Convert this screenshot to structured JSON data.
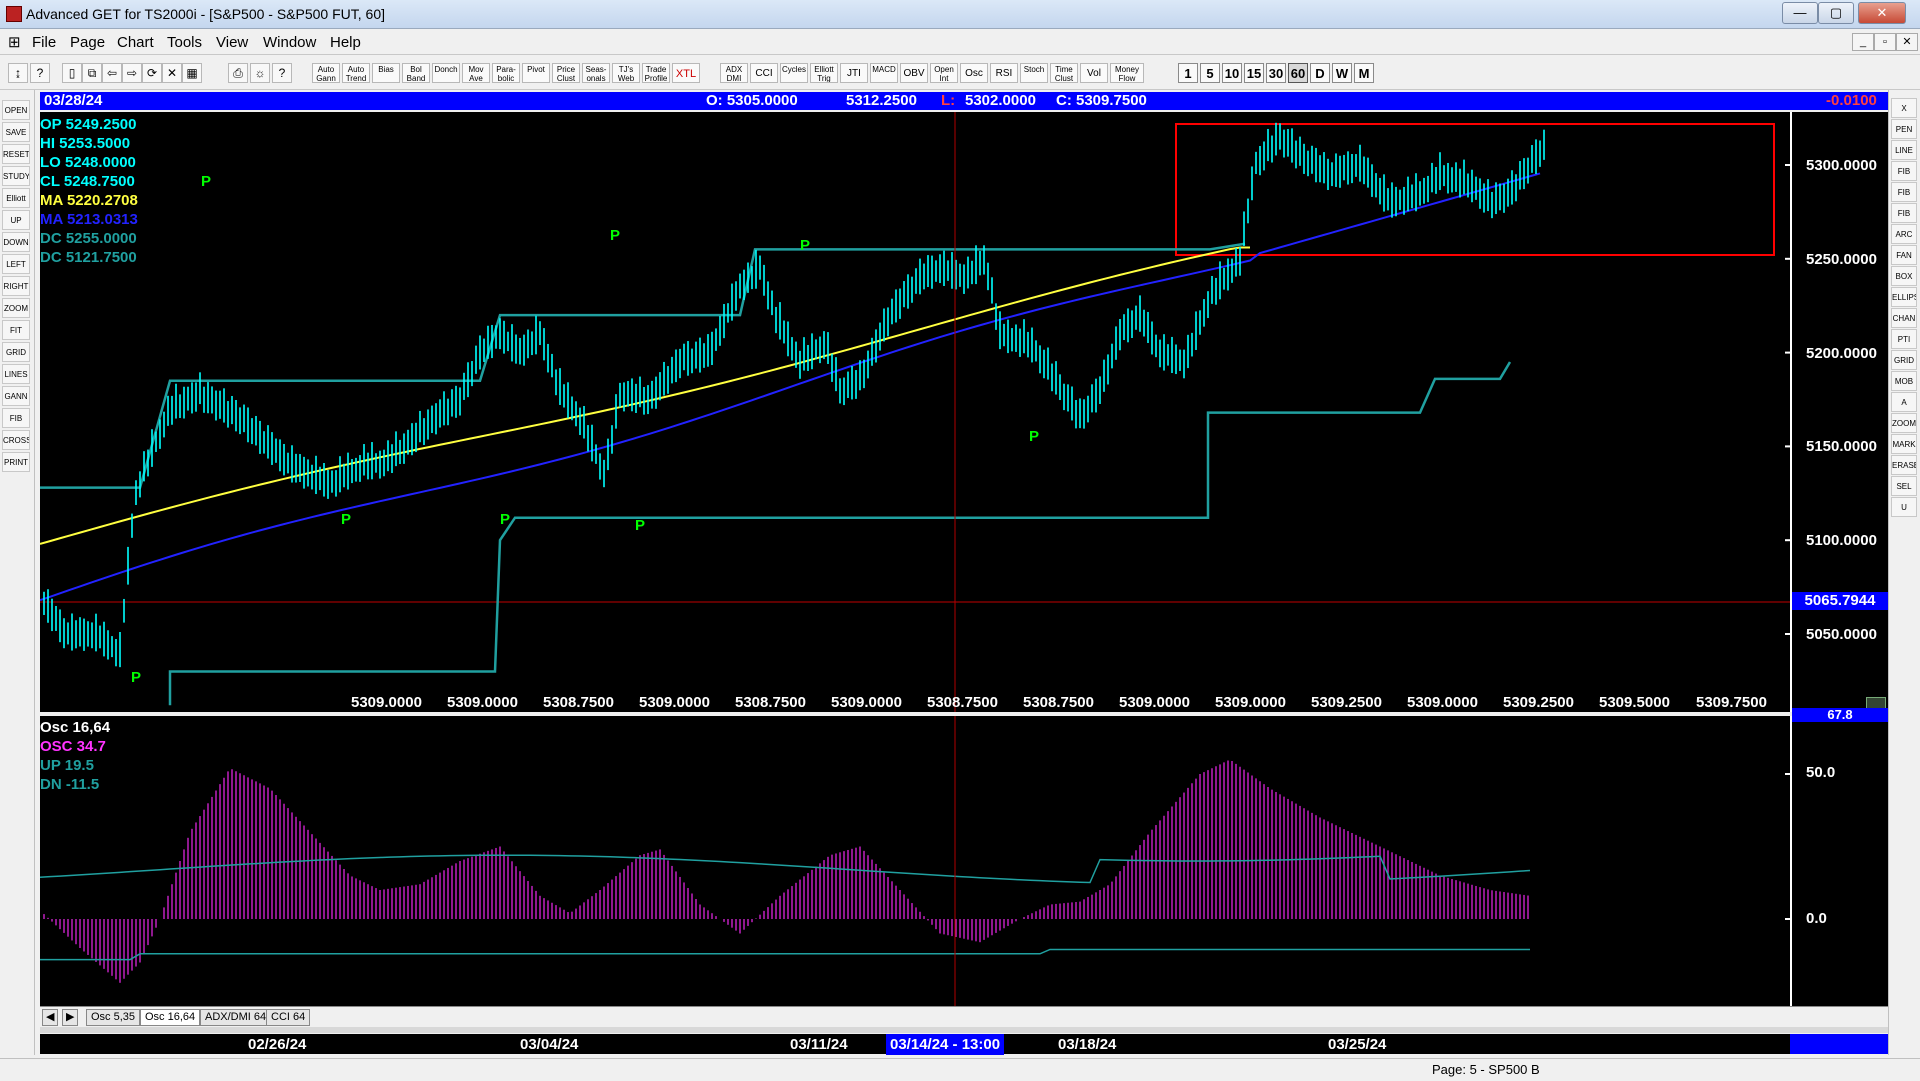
{
  "window": {
    "title": "Advanced GET for TS2000i - [S&P500 - S&P500 FUT, 60]",
    "minimize": "—",
    "maximize": "▢",
    "close": "✕"
  },
  "menu": {
    "items": [
      "File",
      "Page",
      "Chart",
      "Tools",
      "View",
      "Window",
      "Help"
    ],
    "mdi": [
      "_",
      "▫",
      "✕"
    ]
  },
  "toolbar": {
    "studies": [
      "Auto Gann",
      "Auto Trend",
      "Bias",
      "Bol Band",
      "Donch",
      "Mov Ave",
      "Para- bolic",
      "Pivot",
      "Price Clust",
      "Seas- onals",
      "TJ's Web",
      "Trade Profile",
      "XTL",
      "ADX DMI",
      "CCI",
      "Cycles",
      "Elliott Trig",
      "JTI",
      "MACD",
      "OBV",
      "Open Int",
      "Osc",
      "RSI",
      "Stoch",
      "Time Clust",
      "Vol",
      "Money Flow"
    ],
    "timeframes": [
      "1",
      "5",
      "10",
      "15",
      "30",
      "60",
      "D",
      "W",
      "M"
    ],
    "active_timeframe": "60"
  },
  "left_tools": [
    "OPEN",
    "SAVE",
    "RESET",
    "STUDY",
    "Elliott",
    "UP",
    "DOWN",
    "LEFT",
    "RIGHT",
    "ZOOM",
    "FIT",
    "GRID",
    "LINES",
    "GANN",
    "FIB",
    "CROSS",
    "PRINT"
  ],
  "right_tools": [
    "X",
    "PEN",
    "LINE",
    "FIB RET",
    "FIB EXT",
    "FIB TIME",
    "ARC",
    "FAN",
    "BOX",
    "ELLIPSE",
    "CHAN",
    "PTI",
    "GRID",
    "MOB",
    "A",
    "ZOOM",
    "MARK",
    "ERASE",
    "SEL",
    "U"
  ],
  "header": {
    "date": "03/28/24",
    "open": "O: 5305.0000",
    "high": "5312.2500",
    "low_label": "L:",
    "low": "5302.0000",
    "close": "C: 5309.7500",
    "change": "-0.0100"
  },
  "price_legend": {
    "op": "OP  5249.2500",
    "hi": "HI   5253.5000",
    "lo": "LO  5248.0000",
    "cl": "CL  5248.7500",
    "ma1": "MA  5220.2708",
    "ma2": "MA  5213.0313",
    "dc_hi": "DC  5255.0000",
    "dc_lo": "DC  5121.7500"
  },
  "price_axis": {
    "ticks": [
      "5300.0000",
      "5250.0000",
      "5200.0000",
      "5150.0000",
      "5100.0000",
      "5050.0000"
    ],
    "cursor_value": "5065.7944"
  },
  "dc_values": [
    "5309.0000",
    "5309.0000",
    "5308.7500",
    "5309.0000",
    "5308.7500",
    "5309.0000",
    "5308.7500",
    "5308.7500",
    "5309.0000",
    "5309.0000",
    "5309.2500",
    "5309.0000",
    "5309.2500",
    "5309.5000"
  ],
  "dc_last": "5309.7500",
  "pivot_label": "P",
  "osc_legend": {
    "title": "Osc 16,64",
    "osc": "OSC 34.7",
    "up": "UP    19.5",
    "dn": "DN    -11.5"
  },
  "osc_axis": {
    "top": "67.8",
    "ticks": [
      "50.0",
      "0.0"
    ]
  },
  "tabs": [
    "Osc 5,35",
    "Osc 16,64",
    "ADX/DMI 64",
    "CCI 64"
  ],
  "active_tab": "Osc 16,64",
  "tab_nav": [
    "◀",
    "▶"
  ],
  "date_axis": [
    "02/26/24",
    "03/04/24",
    "03/11/24",
    "03/14/24 - 13:00",
    "03/18/24",
    "03/25/24"
  ],
  "status": "Page: 5 - SP500 B",
  "colors": {
    "candles": "#00ffff",
    "ma_fast": "#ffff40",
    "ma_slow": "#2222ff",
    "donchian": "#20a0a0",
    "pivot": "#00ff00",
    "highlight_box": "#ff0000",
    "osc_bars": "#cc22cc",
    "osc_bands": "#20a0a0",
    "header": "#0000ff"
  }
}
